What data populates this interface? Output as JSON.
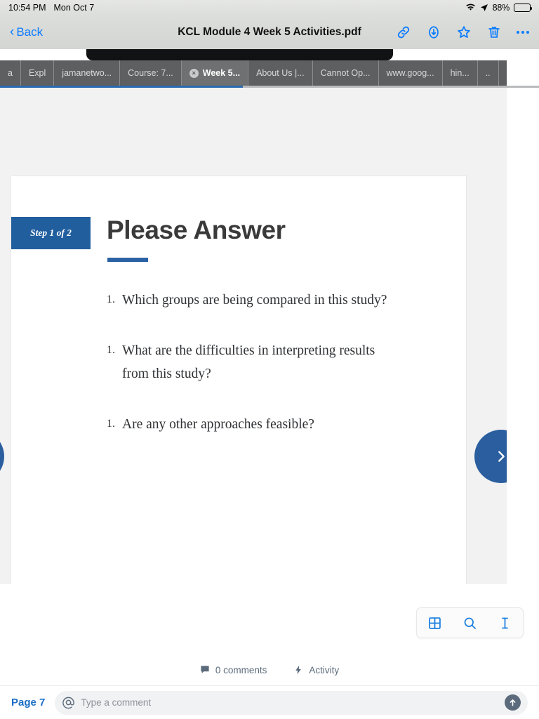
{
  "status_bar": {
    "time": "10:54 PM",
    "date": "Mon Oct 7",
    "battery_percent": "88%",
    "wifi_icon": "wifi-icon",
    "location_icon": "location-arrow-icon",
    "battery_icon": "battery-icon"
  },
  "nav_bar": {
    "back_label": "Back",
    "title": "KCL Module 4 Week 5 Activities.pdf",
    "actions": [
      {
        "name": "link-icon",
        "label": "Link"
      },
      {
        "name": "download-icon",
        "label": "Download"
      },
      {
        "name": "star-icon",
        "label": "Favorite"
      },
      {
        "name": "trash-icon",
        "label": "Delete"
      },
      {
        "name": "more-icon",
        "label": "More"
      }
    ]
  },
  "browser": {
    "tabs": [
      {
        "label": "a",
        "active": false,
        "closable": false
      },
      {
        "label": "Expl",
        "active": false,
        "closable": false
      },
      {
        "label": "jamanetwo...",
        "active": false,
        "closable": false
      },
      {
        "label": "Course: 7...",
        "active": false,
        "closable": false
      },
      {
        "label": "Week 5...",
        "active": true,
        "closable": true
      },
      {
        "label": "About Us |...",
        "active": false,
        "closable": false
      },
      {
        "label": "Cannot Op...",
        "active": false,
        "closable": false
      },
      {
        "label": "www.goog...",
        "active": false,
        "closable": false
      },
      {
        "label": "hin...",
        "active": false,
        "closable": false
      },
      {
        "label": "..",
        "active": false,
        "closable": false
      },
      {
        "label": "",
        "active": false,
        "closable": false
      },
      {
        "label": "",
        "active": false,
        "closable": false
      }
    ],
    "tab_close_glyph": "×",
    "progress_percent": 45
  },
  "slide": {
    "step_badge": "Step 1 of 2",
    "title": "Please Answer",
    "questions": [
      {
        "number": "1.",
        "text": "Which groups are being compared in this study?"
      },
      {
        "number": "1.",
        "text": "What are the difficulties in interpreting results from this study?"
      },
      {
        "number": "1.",
        "text": "Are any other approaches feasible?"
      }
    ],
    "prev_button": "prev-slide-button",
    "next_button": "next-slide-button",
    "accent_color": "#215E9E"
  },
  "viewer_tools": [
    {
      "name": "thumbnails-icon",
      "label": "Thumbnails"
    },
    {
      "name": "search-icon",
      "label": "Search"
    },
    {
      "name": "text-select-icon",
      "label": "Text select"
    }
  ],
  "meta_bar": {
    "comments_label": "0 comments",
    "comments_icon": "comment-icon",
    "activity_label": "Activity",
    "activity_icon": "activity-bolt-icon"
  },
  "composer": {
    "page_label": "Page 7",
    "mention_icon": "at-sign-icon",
    "placeholder": "Type a comment",
    "value": "",
    "send_icon": "send-up-arrow-icon"
  }
}
